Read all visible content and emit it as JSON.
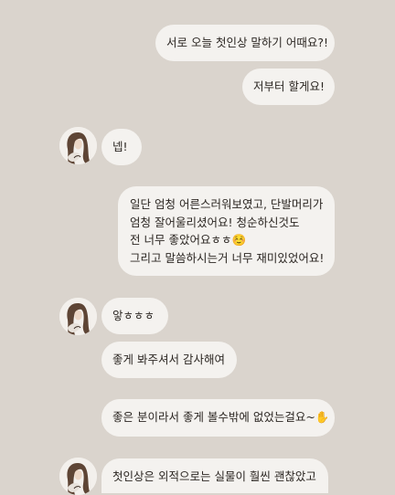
{
  "colors": {
    "background": "#dad4cd",
    "bubble": "#f4f2ef",
    "text": "#2b2622"
  },
  "avatar_icon": "profile-photo-woman-long-hair",
  "messages": [
    {
      "id": "m1",
      "side": "sent",
      "text": "서로 오늘 첫인상 말하기 어때요?!"
    },
    {
      "id": "m2",
      "side": "sent",
      "text": "저부터 할게요!"
    },
    {
      "id": "m3",
      "side": "received",
      "text": "넵!"
    },
    {
      "id": "m4",
      "side": "sent",
      "lines": [
        "일단 엄청 어른스러워보였고, 단발머리가",
        "엄청 잘어울리셨어요! 청순하신것도",
        "전 너무 좋았어요ㅎㅎ☺️",
        "그리고 말씀하시는거 너무 재미있었어요!"
      ]
    },
    {
      "id": "m5",
      "side": "received",
      "text": "앟ㅎㅎㅎ"
    },
    {
      "id": "m6",
      "side": "received",
      "text": "좋게 봐주셔서 감사해여"
    },
    {
      "id": "m7",
      "side": "received",
      "text": "좋은 분이라서 좋게 볼수밖에 없었는걸요~✋"
    },
    {
      "id": "m8",
      "side": "received",
      "text": "첫인상은 외적으로는 실물이 훨씬 괜찮았고"
    }
  ]
}
